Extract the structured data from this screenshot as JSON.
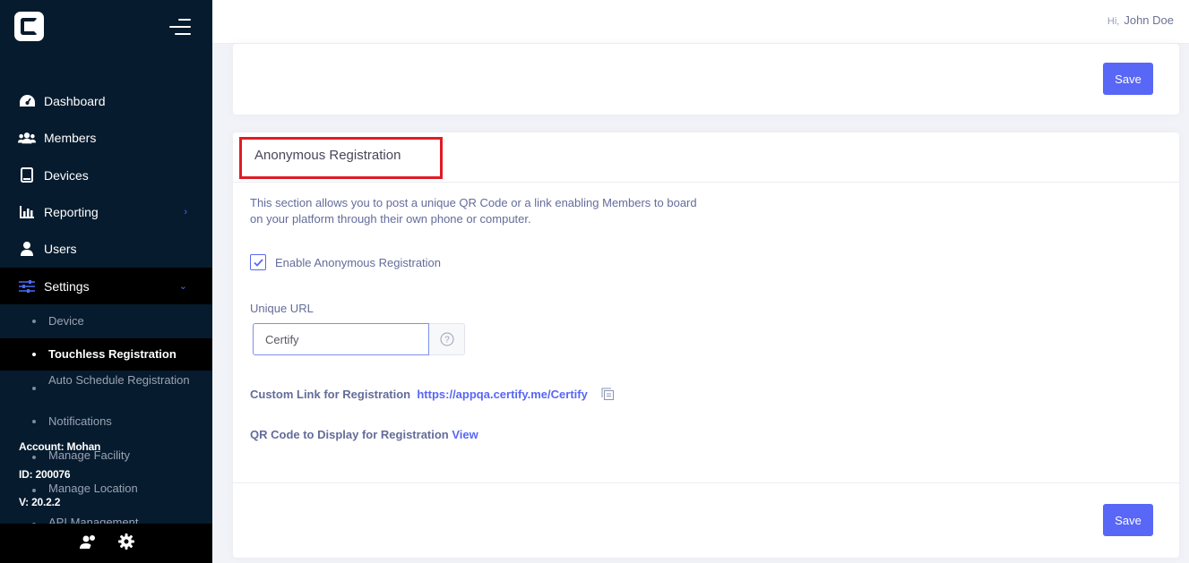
{
  "header": {
    "hi": "Hi,",
    "user_name": "John Doe"
  },
  "sidebar": {
    "items": [
      {
        "label": "Dashboard",
        "icon": "dashboard-icon"
      },
      {
        "label": "Members",
        "icon": "members-icon"
      },
      {
        "label": "Devices",
        "icon": "tablet-icon"
      },
      {
        "label": "Reporting",
        "icon": "chart-icon",
        "chevron": "›"
      },
      {
        "label": "Users",
        "icon": "user-icon"
      },
      {
        "label": "Settings",
        "icon": "sliders-icon",
        "chevron": "⌄"
      }
    ],
    "sub_items": [
      {
        "label": "Device"
      },
      {
        "label": "Touchless Registration"
      },
      {
        "label": "Auto Schedule Registration"
      },
      {
        "label": "Notifications"
      },
      {
        "label": "Manage Facility"
      },
      {
        "label": "Manage Location"
      },
      {
        "label": "API Management"
      }
    ],
    "account": "Account: Mohan",
    "id": "ID: 200076",
    "version": "V: 20.2.2"
  },
  "top_card": {
    "save_label": "Save"
  },
  "anon": {
    "title": "Anonymous Registration",
    "description": "This section allows you to post a unique QR Code or a link enabling Members to board on your platform through their own phone or computer.",
    "enable_label": "Enable Anonymous Registration",
    "enable_checked": true,
    "url_label": "Unique URL",
    "url_value": "Certify",
    "custom_link_label": "Custom Link for Registration",
    "custom_link_url": "https://appqa.certify.me/Certify",
    "qr_label": "QR Code to Display for Registration",
    "qr_link": "View",
    "save_label": "Save"
  },
  "colors": {
    "sidebar_bg": "#061b2e",
    "accent": "#5867f5",
    "highlight_box": "#e01b24"
  }
}
